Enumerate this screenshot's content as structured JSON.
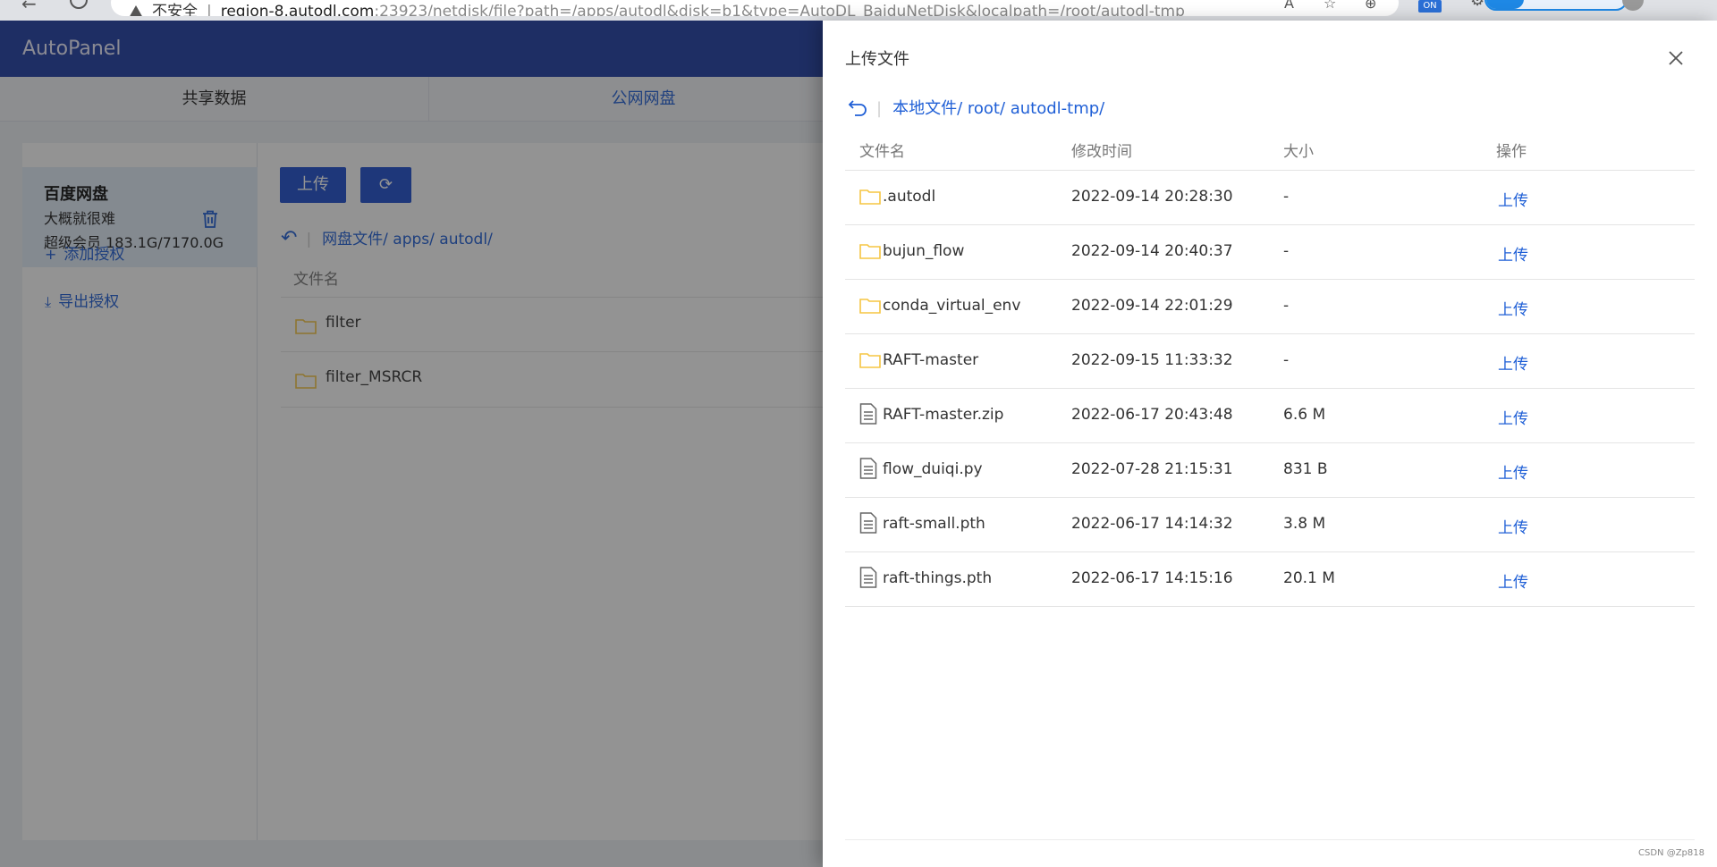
{
  "browser": {
    "address_host": "region-8.autodl.com",
    "address_rest": ":23923/netdisk/file?path=/apps/autodl&disk=b1&type=AutoDL_BaiduNetDisk&localpath=/root/autodl-tmp",
    "security_label": "不安全",
    "badge_on": "ON"
  },
  "app": {
    "brand": "AutoPanel",
    "tabs": [
      {
        "label": "共享数据"
      },
      {
        "label": "公网网盘"
      }
    ]
  },
  "sidebar": {
    "account_name": "百度网盘",
    "account_user": "大概就很难",
    "account_quota": "超级会员 183.1G/7170.0G",
    "add_auth": "添加授权",
    "export_auth": "导出授权"
  },
  "main": {
    "upload_button": "上传",
    "breadcrumb": "网盘文件/ apps/ autodl/",
    "col_name": "文件名",
    "files": [
      {
        "name": "filter"
      },
      {
        "name": "filter_MSRCR"
      }
    ]
  },
  "drawer": {
    "title": "上传文件",
    "breadcrumb": "本地文件/ root/ autodl-tmp/",
    "headers": {
      "name": "文件名",
      "mtime": "修改时间",
      "size": "大小",
      "action": "操作"
    },
    "rows": [
      {
        "type": "folder",
        "name": ".autodl",
        "mtime": "2022-09-14 20:28:30",
        "size": "-",
        "action": "上传"
      },
      {
        "type": "folder",
        "name": "bujun_flow",
        "mtime": "2022-09-14 20:40:37",
        "size": "-",
        "action": "上传"
      },
      {
        "type": "folder",
        "name": "conda_virtual_env",
        "mtime": "2022-09-14 22:01:29",
        "size": "-",
        "action": "上传"
      },
      {
        "type": "folder",
        "name": "RAFT-master",
        "mtime": "2022-09-15 11:33:32",
        "size": "-",
        "action": "上传"
      },
      {
        "type": "file",
        "name": "RAFT-master.zip",
        "mtime": "2022-06-17 20:43:48",
        "size": "6.6 M",
        "action": "上传"
      },
      {
        "type": "file",
        "name": "flow_duiqi.py",
        "mtime": "2022-07-28 21:15:31",
        "size": "831 B",
        "action": "上传"
      },
      {
        "type": "file",
        "name": "raft-small.pth",
        "mtime": "2022-06-17 14:14:32",
        "size": "3.8 M",
        "action": "上传"
      },
      {
        "type": "file",
        "name": "raft-things.pth",
        "mtime": "2022-06-17 14:15:16",
        "size": "20.1 M",
        "action": "上传"
      }
    ]
  },
  "watermark": "CSDN @Zp818",
  "colors": {
    "brand_bar": "#1f3ea6",
    "accent": "#1f5fd6",
    "folder": "#f5c542"
  }
}
